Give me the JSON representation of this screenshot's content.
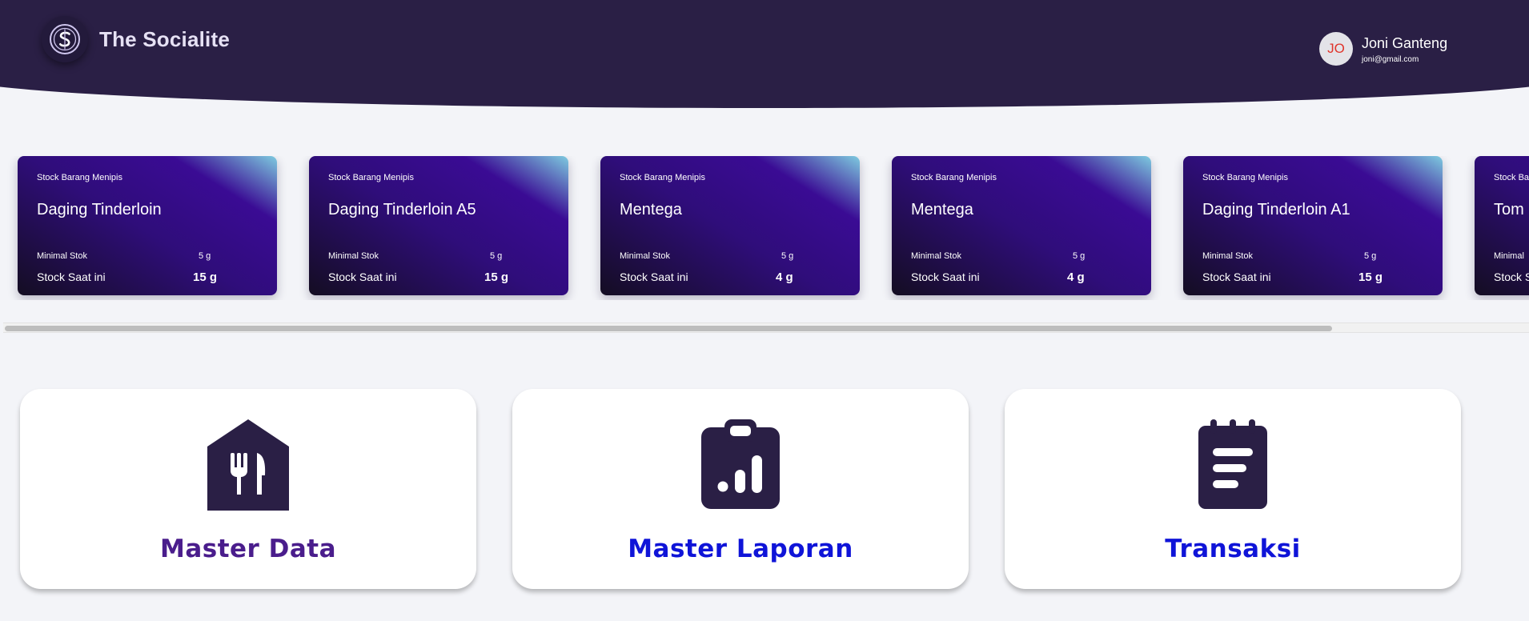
{
  "app": {
    "name": "The Socialite",
    "logo_icon": "socialite-s-logo-icon"
  },
  "user": {
    "initials": "JO",
    "name": "Joni Ganteng",
    "email": "joni@gmail.com"
  },
  "stock_cards": [
    {
      "label": "Stock Barang Menipis",
      "title": "Daging Tinderloin",
      "min_label": "Minimal Stok",
      "min_value": "5 g",
      "current_label": "Stock Saat ini",
      "current_value": "15 g"
    },
    {
      "label": "Stock Barang Menipis",
      "title": "Daging Tinderloin A5",
      "min_label": "Minimal Stok",
      "min_value": "5 g",
      "current_label": "Stock Saat ini",
      "current_value": "15 g"
    },
    {
      "label": "Stock Barang Menipis",
      "title": "Mentega",
      "min_label": "Minimal Stok",
      "min_value": "5 g",
      "current_label": "Stock Saat ini",
      "current_value": "4 g"
    },
    {
      "label": "Stock Barang Menipis",
      "title": "Mentega",
      "min_label": "Minimal Stok",
      "min_value": "5 g",
      "current_label": "Stock Saat ini",
      "current_value": "4 g"
    },
    {
      "label": "Stock Barang Menipis",
      "title": "Daging Tinderloin A1",
      "min_label": "Minimal Stok",
      "min_value": "5 g",
      "current_label": "Stock Saat ini",
      "current_value": "15 g"
    },
    {
      "label": "Stock Barang Menipis",
      "title": "Tom",
      "min_label": "Minimal",
      "min_value": "",
      "current_label": "Stock S",
      "current_value": ""
    }
  ],
  "scrollbar": {
    "visible_fraction": 0.87
  },
  "menu": [
    {
      "label": "Master Data",
      "icon": "restaurant-home-icon",
      "color": "#4a1d8c"
    },
    {
      "label": "Master Laporan",
      "icon": "clipboard-chart-icon",
      "color": "#0f14d8"
    },
    {
      "label": "Transaksi",
      "icon": "notepad-icon",
      "color": "#0f14d8"
    }
  ],
  "colors": {
    "header": "#2a1f45",
    "background": "#f3f4f8",
    "icon_dark": "#2a1f45"
  }
}
